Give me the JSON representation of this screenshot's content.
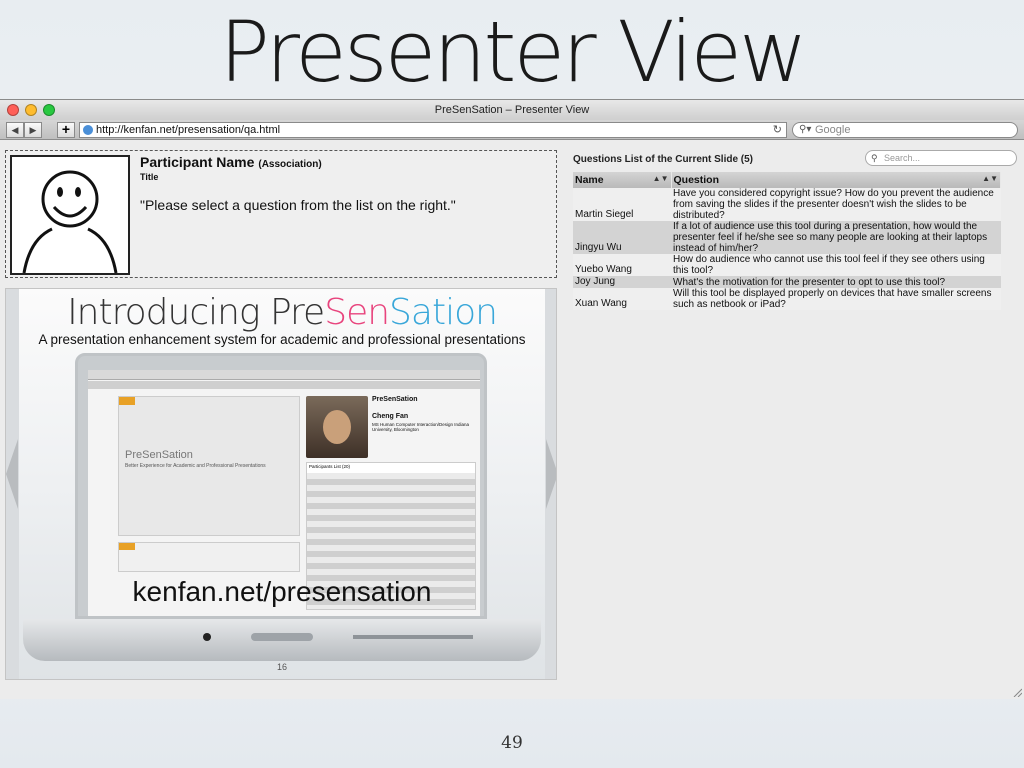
{
  "slide": {
    "title": "Presenter View",
    "page_number": "49"
  },
  "window": {
    "title": "PreSenSation – Presenter View",
    "url": "http://kenfan.net/presensation/qa.html",
    "search_placeholder": "Google"
  },
  "participant": {
    "name": "Participant Name",
    "association": "(Association)",
    "title": "Title",
    "prompt": "\"Please select a question from the list on the right.\""
  },
  "preview": {
    "heading_part1": "Introducing Pre",
    "heading_part2": "Sen",
    "heading_part3": "Sation",
    "subtitle": "A presentation enhancement system for academic and professional presentations",
    "url": "kenfan.net/presensation",
    "page": "16",
    "inner": {
      "brand": "PreSenSation",
      "tagline": "Better Experience for Academic and Professional Presentations",
      "presenter": "Cheng Fan",
      "presenter_info": "MS Human Computer Interaction/Design Indiana University, Bloomington",
      "list_title": "Participants List (20)"
    }
  },
  "questions": {
    "heading": "Questions List of the Current Slide (5)",
    "search_placeholder": "Search...",
    "columns": [
      "Name",
      "Question"
    ],
    "rows": [
      {
        "name": "Martin Siegel",
        "question": "Have you considered copyright issue? How do you prevent the audience from saving the slides if the presenter doesn't wish the slides to be distributed?"
      },
      {
        "name": "Jingyu Wu",
        "question": "If a lot of audience use this tool during a presentation, how would the presenter feel if he/she see so many people are looking at their laptops instead of him/her?"
      },
      {
        "name": "Yuebo Wang",
        "question": "How do audience who cannot use this tool feel if they see others using this tool?"
      },
      {
        "name": "Joy Jung",
        "question": "What's the motivation for the presenter to opt to use this tool?"
      },
      {
        "name": "Xuan Wang",
        "question": "Will this tool be displayed properly on devices that have smaller screens such as netbook or iPad?"
      }
    ]
  },
  "colors": {
    "close": "#ff5f57",
    "minimize": "#febc2e",
    "zoom": "#28c840",
    "accent_pink": "#e8447d",
    "accent_blue": "#39a7d9"
  }
}
